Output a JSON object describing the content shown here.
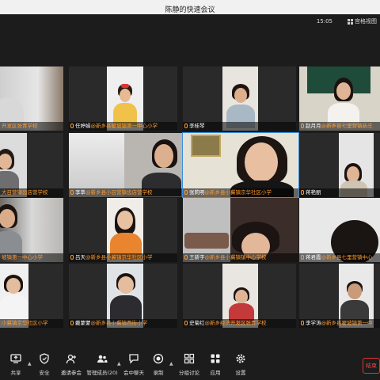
{
  "window": {
    "title": "陈静的快速会议"
  },
  "topbar": {
    "time": "15:05",
    "view_label": "宫格视图"
  },
  "tiles": [
    {
      "name": "",
      "school": "开发区张青学校"
    },
    {
      "name": "任婷娟",
      "school": "@新乡县翟坡镇第一中心小学"
    },
    {
      "name": "",
      "school": ""
    },
    {
      "name": "李桂琴",
      "school": ""
    },
    {
      "name": "赵月月",
      "school": "@新乡县七里营镇新庄"
    },
    {
      "name": "",
      "school": "大召营镇齿店营学校"
    },
    {
      "name": "李萃",
      "school": "@新乡县小召营镇齿店营学校"
    },
    {
      "name": "张莉明",
      "school": "@新乡县小冀镇京华社区小学"
    },
    {
      "name": "蒋艳丽",
      "school": ""
    },
    {
      "name": "",
      "school": "坡镇第一中心小学"
    },
    {
      "name": "吕天",
      "school": "@新乡县小冀镇京华社区小学"
    },
    {
      "name": "王新宇",
      "school": "@新乡县小冀镇镇中心学校"
    },
    {
      "name": "蒋君霞",
      "school": "@新乡县七里营镇中心"
    },
    {
      "name": "",
      "school": "小冀镇京华社区小学"
    },
    {
      "name": "戴蒙蒙",
      "school": "@新乡县小冀镇西街小学"
    },
    {
      "name": "史菊红",
      "school": "@新乡经济开发区张青学校"
    },
    {
      "name": "李学涛",
      "school": "@新乡县翟坡镇第一中"
    }
  ],
  "toolbar": {
    "share": "共享",
    "security": "安全",
    "invite": "邀请参会",
    "members": "管理成员(20)",
    "chat": "会中聊天",
    "record": "录制",
    "breakout": "分组讨论",
    "apps": "应用",
    "settings": "设置",
    "end": "结束"
  }
}
